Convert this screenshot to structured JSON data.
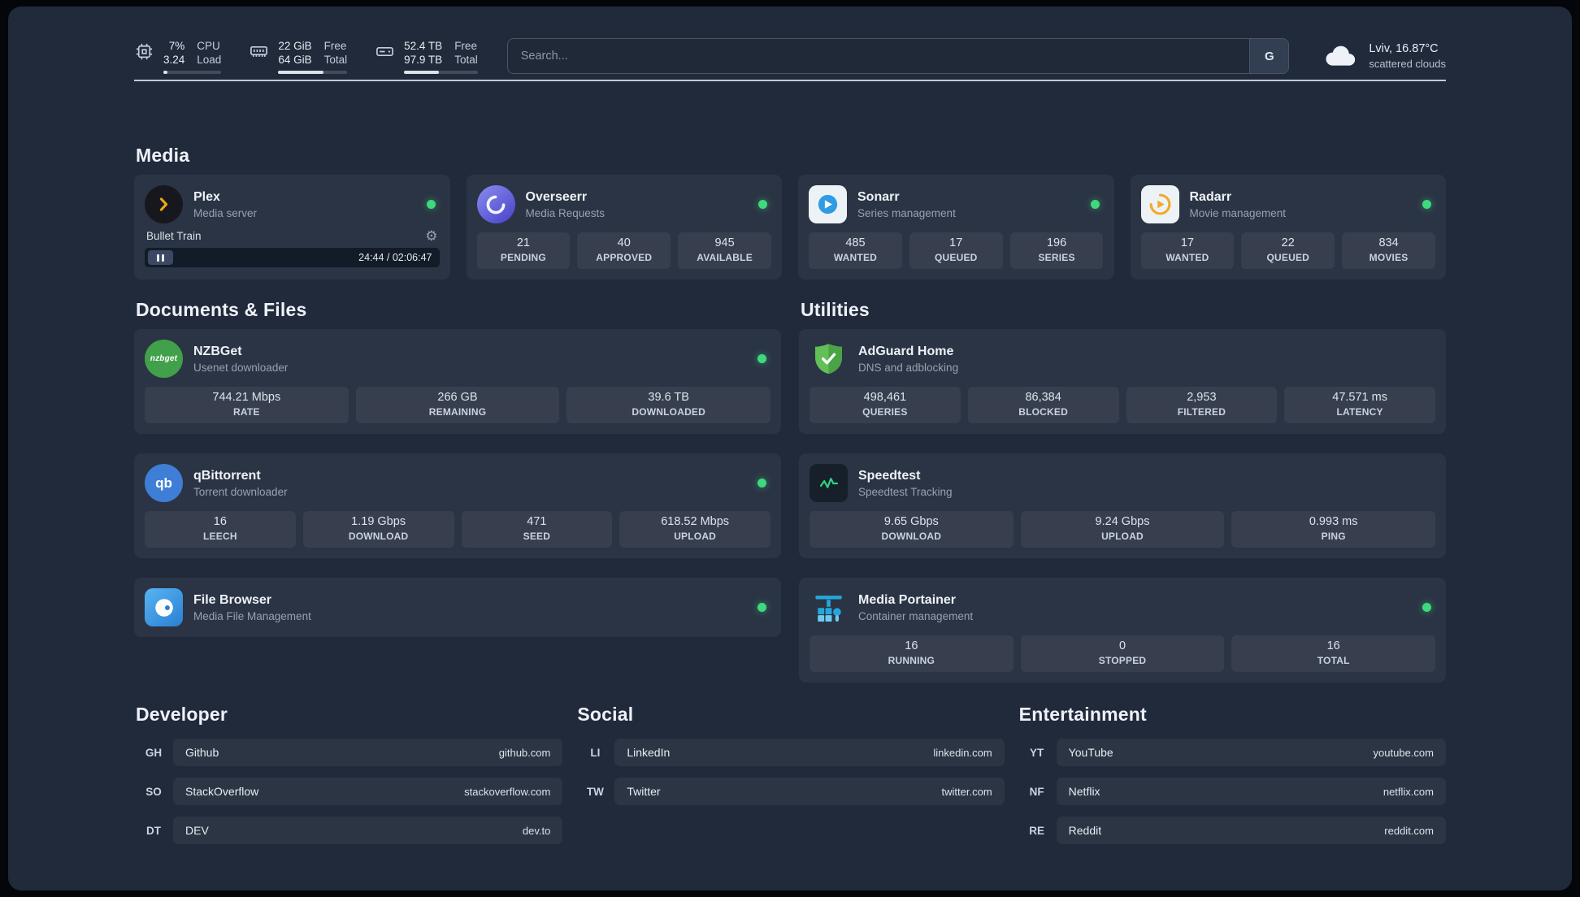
{
  "topbar": {
    "widgets": [
      {
        "id": "cpu",
        "icon": "cpu",
        "values": [
          "7%",
          "3.24"
        ],
        "labels": [
          "CPU",
          "Load"
        ],
        "progress_percent": 7
      },
      {
        "id": "memory",
        "icon": "memory",
        "values": [
          "22 GiB",
          "64 GiB"
        ],
        "labels": [
          "Free",
          "Total"
        ],
        "progress_percent": 66
      },
      {
        "id": "disk",
        "icon": "disk",
        "values": [
          "52.4 TB",
          "97.9 TB"
        ],
        "labels": [
          "Free",
          "Total"
        ],
        "progress_percent": 47
      }
    ],
    "search": {
      "placeholder": "Search...",
      "provider_label": "G"
    },
    "weather": {
      "icon": "cloud",
      "location": "Lviv, 16.87°C",
      "condition": "scattered clouds"
    }
  },
  "sections": {
    "media": {
      "title": "Media",
      "cards": [
        {
          "name": "Plex",
          "description": "Media server",
          "icon": "plex",
          "status": "online",
          "player": {
            "track": "Bullet Train",
            "time": "24:44 / 02:06:47"
          }
        },
        {
          "name": "Overseerr",
          "description": "Media Requests",
          "icon": "overseerr",
          "status": "online",
          "stats": [
            {
              "value": "21",
              "label": "PENDING"
            },
            {
              "value": "40",
              "label": "APPROVED"
            },
            {
              "value": "945",
              "label": "AVAILABLE"
            }
          ]
        },
        {
          "name": "Sonarr",
          "description": "Series management",
          "icon": "sonarr",
          "status": "online",
          "stats": [
            {
              "value": "485",
              "label": "WANTED"
            },
            {
              "value": "17",
              "label": "QUEUED"
            },
            {
              "value": "196",
              "label": "SERIES"
            }
          ]
        },
        {
          "name": "Radarr",
          "description": "Movie management",
          "icon": "radarr",
          "status": "online",
          "stats": [
            {
              "value": "17",
              "label": "WANTED"
            },
            {
              "value": "22",
              "label": "QUEUED"
            },
            {
              "value": "834",
              "label": "MOVIES"
            }
          ]
        }
      ]
    },
    "documents": {
      "title": "Documents & Files",
      "cards": [
        {
          "name": "NZBGet",
          "description": "Usenet downloader",
          "icon": "nzbget",
          "status": "online",
          "stats": [
            {
              "value": "744.21 Mbps",
              "label": "RATE"
            },
            {
              "value": "266 GB",
              "label": "REMAINING"
            },
            {
              "value": "39.6 TB",
              "label": "DOWNLOADED"
            }
          ]
        },
        {
          "name": "qBittorrent",
          "description": "Torrent downloader",
          "icon": "qbittorrent",
          "status": "online",
          "stats": [
            {
              "value": "16",
              "label": "LEECH"
            },
            {
              "value": "1.19 Gbps",
              "label": "DOWNLOAD"
            },
            {
              "value": "471",
              "label": "SEED"
            },
            {
              "value": "618.52 Mbps",
              "label": "UPLOAD"
            }
          ]
        },
        {
          "name": "File Browser",
          "description": "Media File Management",
          "icon": "filebrowser",
          "status": "online"
        }
      ]
    },
    "utilities": {
      "title": "Utilities",
      "cards": [
        {
          "name": "AdGuard Home",
          "description": "DNS and adblocking",
          "icon": "adguard",
          "status": null,
          "stats": [
            {
              "value": "498,461",
              "label": "QUERIES"
            },
            {
              "value": "86,384",
              "label": "BLOCKED"
            },
            {
              "value": "2,953",
              "label": "FILTERED"
            },
            {
              "value": "47.571 ms",
              "label": "LATENCY"
            }
          ]
        },
        {
          "name": "Speedtest",
          "description": "Speedtest Tracking",
          "icon": "speedtest",
          "status": null,
          "stats": [
            {
              "value": "9.65 Gbps",
              "label": "DOWNLOAD"
            },
            {
              "value": "9.24 Gbps",
              "label": "UPLOAD"
            },
            {
              "value": "0.993 ms",
              "label": "PING"
            }
          ]
        },
        {
          "name": "Media Portainer",
          "description": "Container management",
          "icon": "portainer",
          "status": "online",
          "stats": [
            {
              "value": "16",
              "label": "RUNNING"
            },
            {
              "value": "0",
              "label": "STOPPED"
            },
            {
              "value": "16",
              "label": "TOTAL"
            }
          ]
        }
      ]
    }
  },
  "bookmarks": [
    {
      "title": "Developer",
      "items": [
        {
          "abbr": "GH",
          "name": "Github",
          "url": "github.com"
        },
        {
          "abbr": "SO",
          "name": "StackOverflow",
          "url": "stackoverflow.com"
        },
        {
          "abbr": "DT",
          "name": "DEV",
          "url": "dev.to"
        }
      ]
    },
    {
      "title": "Social",
      "items": [
        {
          "abbr": "LI",
          "name": "LinkedIn",
          "url": "linkedin.com"
        },
        {
          "abbr": "TW",
          "name": "Twitter",
          "url": "twitter.com"
        }
      ]
    },
    {
      "title": "Entertainment",
      "items": [
        {
          "abbr": "YT",
          "name": "YouTube",
          "url": "youtube.com"
        },
        {
          "abbr": "NF",
          "name": "Netflix",
          "url": "netflix.com"
        },
        {
          "abbr": "RE",
          "name": "Reddit",
          "url": "reddit.com"
        }
      ]
    }
  ],
  "colors": {
    "status_online": "#3ed97d",
    "background": "#202a3a",
    "card": "rgba(255,255,255,0.05)",
    "accent_green": "#2ed47f"
  }
}
